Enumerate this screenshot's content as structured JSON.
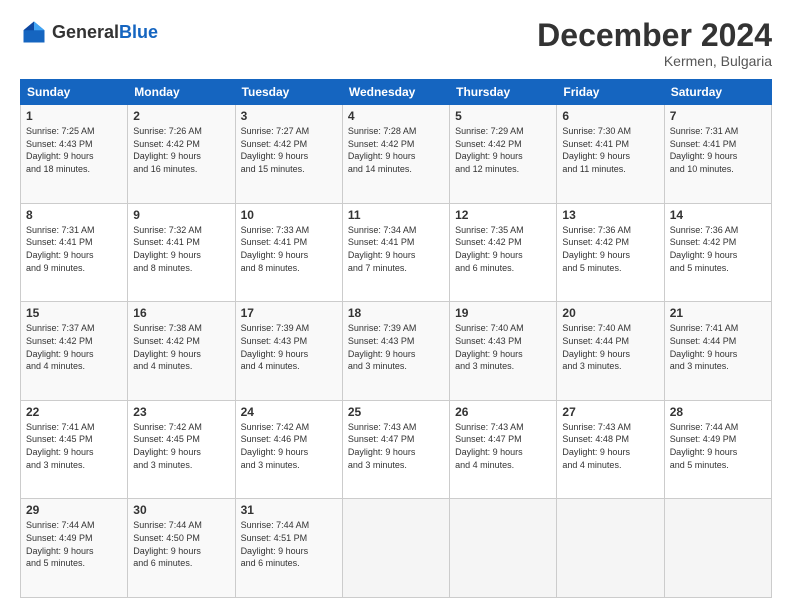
{
  "header": {
    "logo_general": "General",
    "logo_blue": "Blue",
    "month_title": "December 2024",
    "subtitle": "Kermen, Bulgaria"
  },
  "weekdays": [
    "Sunday",
    "Monday",
    "Tuesday",
    "Wednesday",
    "Thursday",
    "Friday",
    "Saturday"
  ],
  "weeks": [
    [
      {
        "day": "1",
        "lines": [
          "Sunrise: 7:25 AM",
          "Sunset: 4:43 PM",
          "Daylight: 9 hours",
          "and 18 minutes."
        ]
      },
      {
        "day": "2",
        "lines": [
          "Sunrise: 7:26 AM",
          "Sunset: 4:42 PM",
          "Daylight: 9 hours",
          "and 16 minutes."
        ]
      },
      {
        "day": "3",
        "lines": [
          "Sunrise: 7:27 AM",
          "Sunset: 4:42 PM",
          "Daylight: 9 hours",
          "and 15 minutes."
        ]
      },
      {
        "day": "4",
        "lines": [
          "Sunrise: 7:28 AM",
          "Sunset: 4:42 PM",
          "Daylight: 9 hours",
          "and 14 minutes."
        ]
      },
      {
        "day": "5",
        "lines": [
          "Sunrise: 7:29 AM",
          "Sunset: 4:42 PM",
          "Daylight: 9 hours",
          "and 12 minutes."
        ]
      },
      {
        "day": "6",
        "lines": [
          "Sunrise: 7:30 AM",
          "Sunset: 4:41 PM",
          "Daylight: 9 hours",
          "and 11 minutes."
        ]
      },
      {
        "day": "7",
        "lines": [
          "Sunrise: 7:31 AM",
          "Sunset: 4:41 PM",
          "Daylight: 9 hours",
          "and 10 minutes."
        ]
      }
    ],
    [
      {
        "day": "8",
        "lines": [
          "Sunrise: 7:31 AM",
          "Sunset: 4:41 PM",
          "Daylight: 9 hours",
          "and 9 minutes."
        ]
      },
      {
        "day": "9",
        "lines": [
          "Sunrise: 7:32 AM",
          "Sunset: 4:41 PM",
          "Daylight: 9 hours",
          "and 8 minutes."
        ]
      },
      {
        "day": "10",
        "lines": [
          "Sunrise: 7:33 AM",
          "Sunset: 4:41 PM",
          "Daylight: 9 hours",
          "and 8 minutes."
        ]
      },
      {
        "day": "11",
        "lines": [
          "Sunrise: 7:34 AM",
          "Sunset: 4:41 PM",
          "Daylight: 9 hours",
          "and 7 minutes."
        ]
      },
      {
        "day": "12",
        "lines": [
          "Sunrise: 7:35 AM",
          "Sunset: 4:42 PM",
          "Daylight: 9 hours",
          "and 6 minutes."
        ]
      },
      {
        "day": "13",
        "lines": [
          "Sunrise: 7:36 AM",
          "Sunset: 4:42 PM",
          "Daylight: 9 hours",
          "and 5 minutes."
        ]
      },
      {
        "day": "14",
        "lines": [
          "Sunrise: 7:36 AM",
          "Sunset: 4:42 PM",
          "Daylight: 9 hours",
          "and 5 minutes."
        ]
      }
    ],
    [
      {
        "day": "15",
        "lines": [
          "Sunrise: 7:37 AM",
          "Sunset: 4:42 PM",
          "Daylight: 9 hours",
          "and 4 minutes."
        ]
      },
      {
        "day": "16",
        "lines": [
          "Sunrise: 7:38 AM",
          "Sunset: 4:42 PM",
          "Daylight: 9 hours",
          "and 4 minutes."
        ]
      },
      {
        "day": "17",
        "lines": [
          "Sunrise: 7:39 AM",
          "Sunset: 4:43 PM",
          "Daylight: 9 hours",
          "and 4 minutes."
        ]
      },
      {
        "day": "18",
        "lines": [
          "Sunrise: 7:39 AM",
          "Sunset: 4:43 PM",
          "Daylight: 9 hours",
          "and 3 minutes."
        ]
      },
      {
        "day": "19",
        "lines": [
          "Sunrise: 7:40 AM",
          "Sunset: 4:43 PM",
          "Daylight: 9 hours",
          "and 3 minutes."
        ]
      },
      {
        "day": "20",
        "lines": [
          "Sunrise: 7:40 AM",
          "Sunset: 4:44 PM",
          "Daylight: 9 hours",
          "and 3 minutes."
        ]
      },
      {
        "day": "21",
        "lines": [
          "Sunrise: 7:41 AM",
          "Sunset: 4:44 PM",
          "Daylight: 9 hours",
          "and 3 minutes."
        ]
      }
    ],
    [
      {
        "day": "22",
        "lines": [
          "Sunrise: 7:41 AM",
          "Sunset: 4:45 PM",
          "Daylight: 9 hours",
          "and 3 minutes."
        ]
      },
      {
        "day": "23",
        "lines": [
          "Sunrise: 7:42 AM",
          "Sunset: 4:45 PM",
          "Daylight: 9 hours",
          "and 3 minutes."
        ]
      },
      {
        "day": "24",
        "lines": [
          "Sunrise: 7:42 AM",
          "Sunset: 4:46 PM",
          "Daylight: 9 hours",
          "and 3 minutes."
        ]
      },
      {
        "day": "25",
        "lines": [
          "Sunrise: 7:43 AM",
          "Sunset: 4:47 PM",
          "Daylight: 9 hours",
          "and 3 minutes."
        ]
      },
      {
        "day": "26",
        "lines": [
          "Sunrise: 7:43 AM",
          "Sunset: 4:47 PM",
          "Daylight: 9 hours",
          "and 4 minutes."
        ]
      },
      {
        "day": "27",
        "lines": [
          "Sunrise: 7:43 AM",
          "Sunset: 4:48 PM",
          "Daylight: 9 hours",
          "and 4 minutes."
        ]
      },
      {
        "day": "28",
        "lines": [
          "Sunrise: 7:44 AM",
          "Sunset: 4:49 PM",
          "Daylight: 9 hours",
          "and 5 minutes."
        ]
      }
    ],
    [
      {
        "day": "29",
        "lines": [
          "Sunrise: 7:44 AM",
          "Sunset: 4:49 PM",
          "Daylight: 9 hours",
          "and 5 minutes."
        ]
      },
      {
        "day": "30",
        "lines": [
          "Sunrise: 7:44 AM",
          "Sunset: 4:50 PM",
          "Daylight: 9 hours",
          "and 6 minutes."
        ]
      },
      {
        "day": "31",
        "lines": [
          "Sunrise: 7:44 AM",
          "Sunset: 4:51 PM",
          "Daylight: 9 hours",
          "and 6 minutes."
        ]
      },
      null,
      null,
      null,
      null
    ]
  ]
}
